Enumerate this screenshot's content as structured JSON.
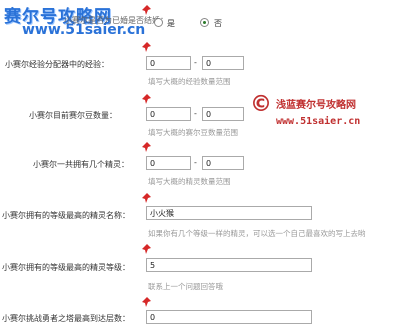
{
  "watermark": {
    "site_name": "赛尔号攻略网",
    "site_url": "www.51saier.cn",
    "middle_name": "浅蓝赛尔号攻略网",
    "middle_url": "www.51saier.cn",
    "copyright": "©"
  },
  "form": {
    "row1": {
      "label": "小赛尔是否为已婚是否结婚：",
      "option_yes": "是",
      "option_no": "否",
      "selected": "否"
    },
    "row2": {
      "label": "小赛尔经验分配器中的经验：",
      "min": "0",
      "sep": "-",
      "max": "0",
      "hint": "填写大概的经验数量范围"
    },
    "row3": {
      "label": "小赛尔目前赛尔豆数量：",
      "min": "0",
      "sep": "-",
      "max": "0",
      "hint": "填写大概的赛尔豆数量范围"
    },
    "row4": {
      "label": "小赛尔一共拥有几个精灵：",
      "min": "0",
      "sep": "-",
      "max": "0",
      "hint": "填写大概的精灵数量范围"
    },
    "row5": {
      "label": "小赛尔拥有的等级最高的精灵名称：",
      "value": "小火猴",
      "hint": "如果你有几个等级一样的精灵，可以选一个自己最喜欢的写上去哟"
    },
    "row6": {
      "label": "小赛尔拥有的等级最高的精灵等级：",
      "value": "5",
      "hint": "联系上一个问题回答哦"
    },
    "row7": {
      "label": "小赛尔挑战勇者之塔最高到达层数：",
      "value": "0"
    }
  },
  "colors": {
    "pin": "#d62828",
    "watermark_blue": "#2a72d8",
    "watermark_red": "#c03030"
  }
}
